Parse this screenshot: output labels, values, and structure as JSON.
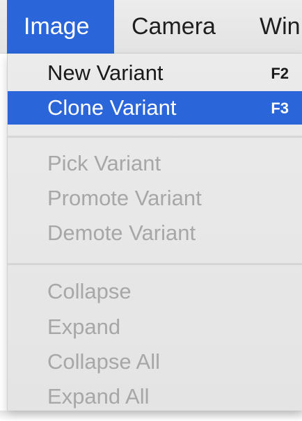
{
  "menubar": {
    "items": [
      {
        "label": "Image",
        "active": true
      },
      {
        "label": "Camera",
        "active": false
      },
      {
        "label": "Win",
        "active": false
      }
    ]
  },
  "menu": {
    "group1": [
      {
        "label": "New Variant",
        "shortcut": "F2",
        "enabled": true,
        "highlighted": false
      },
      {
        "label": "Clone Variant",
        "shortcut": "F3",
        "enabled": true,
        "highlighted": true
      }
    ],
    "group2": [
      {
        "label": "Pick Variant",
        "enabled": false
      },
      {
        "label": "Promote Variant",
        "enabled": false
      },
      {
        "label": "Demote Variant",
        "enabled": false
      }
    ],
    "group3": [
      {
        "label": "Collapse",
        "enabled": false
      },
      {
        "label": "Expand",
        "enabled": false
      },
      {
        "label": "Collapse All",
        "enabled": false
      },
      {
        "label": "Expand All",
        "enabled": false
      }
    ]
  },
  "colors": {
    "highlight": "#2a66d9",
    "disabled_text": "#a7a7a7",
    "menu_background": "#e8e8e8"
  }
}
